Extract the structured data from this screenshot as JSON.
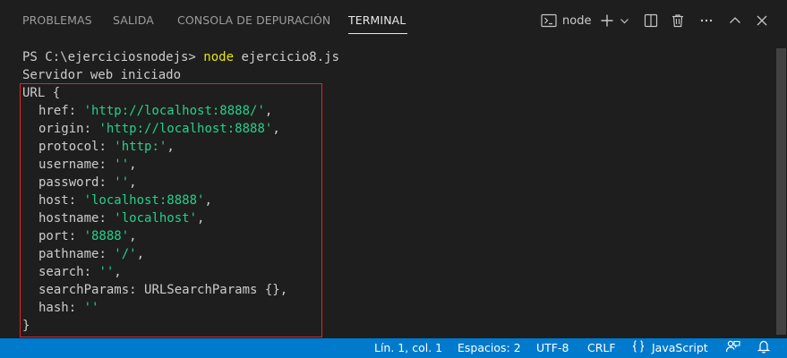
{
  "tabs": [
    {
      "label": "PROBLEMAS",
      "active": false
    },
    {
      "label": "SALIDA",
      "active": false
    },
    {
      "label": "CONSOLA DE DEPURACIÓN",
      "active": false
    },
    {
      "label": "TERMINAL",
      "active": true
    }
  ],
  "toolbar": {
    "terminal_label": "node",
    "icons": [
      "terminal-icon",
      "plus-icon",
      "chevron-down-icon",
      "split-icon",
      "trash-icon",
      "more-icon",
      "chevron-up-icon",
      "close-icon"
    ]
  },
  "terminal": {
    "prompt": "PS C:\\ejerciciosnodejs> ",
    "command": "node",
    "args": " ejercicio8.js",
    "output_line": "Servidor web iniciado",
    "url_open": "URL {",
    "url_fields": [
      {
        "key": "href",
        "value": "'http://localhost:8888/'",
        "suffix": ",",
        "is_string": true
      },
      {
        "key": "origin",
        "value": "'http://localhost:8888'",
        "suffix": ",",
        "is_string": true
      },
      {
        "key": "protocol",
        "value": "'http:'",
        "suffix": ",",
        "is_string": true
      },
      {
        "key": "username",
        "value": "''",
        "suffix": ",",
        "is_string": true
      },
      {
        "key": "password",
        "value": "''",
        "suffix": ",",
        "is_string": true
      },
      {
        "key": "host",
        "value": "'localhost:8888'",
        "suffix": ",",
        "is_string": true
      },
      {
        "key": "hostname",
        "value": "'localhost'",
        "suffix": ",",
        "is_string": true
      },
      {
        "key": "port",
        "value": "'8888'",
        "suffix": ",",
        "is_string": true
      },
      {
        "key": "pathname",
        "value": "'/'",
        "suffix": ",",
        "is_string": true
      },
      {
        "key": "search",
        "value": "''",
        "suffix": ",",
        "is_string": true
      },
      {
        "key": "searchParams",
        "value": "URLSearchParams {}",
        "suffix": ",",
        "is_string": false
      },
      {
        "key": "hash",
        "value": "''",
        "suffix": "",
        "is_string": true
      }
    ],
    "url_close": "}"
  },
  "status_bar": {
    "position": "Lín. 1, col. 1",
    "spaces": "Espacios: 2",
    "encoding": "UTF-8",
    "eol": "CRLF",
    "language_icon": "braces-icon",
    "language": "JavaScript",
    "icons": [
      "feedback-icon",
      "bell-icon"
    ]
  },
  "colors": {
    "background": "#1e1e1e",
    "status_bar": "#007acc",
    "command": "#e5e510",
    "string": "#23d18b",
    "highlight_border": "#e32424"
  }
}
